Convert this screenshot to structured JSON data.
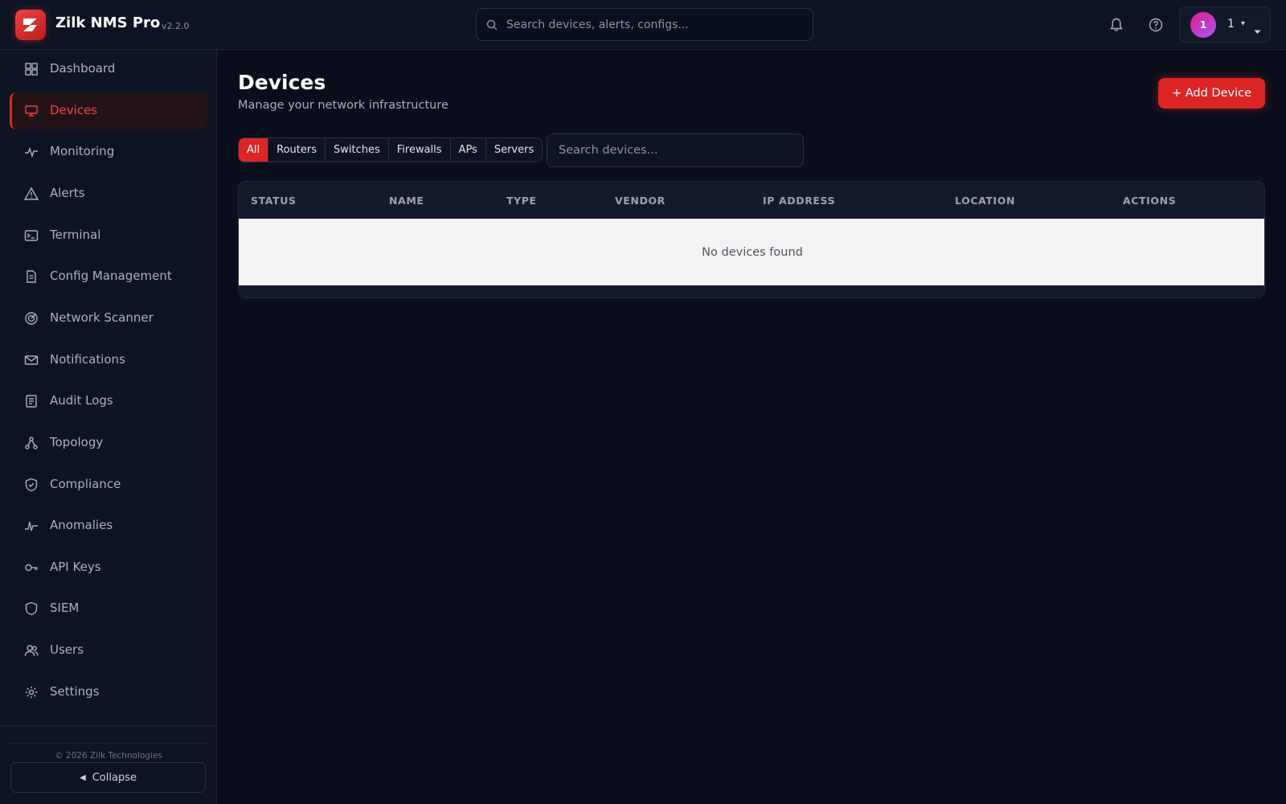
{
  "header": {
    "app_name": "Zilk NMS Pro",
    "version": "v2.2.0",
    "search_placeholder": "Search devices, alerts, configs...",
    "icons": [
      "bell-icon",
      "help-icon"
    ],
    "user": {
      "avatar_initial": "1",
      "name": "1",
      "caret": "▾"
    }
  },
  "sidebar": {
    "items": [
      {
        "label": "Dashboard",
        "icon": "dashboard-icon"
      },
      {
        "label": "Devices",
        "icon": "devices-icon",
        "active": true
      },
      {
        "label": "Monitoring",
        "icon": "monitoring-icon"
      },
      {
        "label": "Alerts",
        "icon": "alerts-icon"
      },
      {
        "label": "Terminal",
        "icon": "terminal-icon"
      },
      {
        "label": "Config Management",
        "icon": "config-icon"
      },
      {
        "label": "Network Scanner",
        "icon": "scanner-icon"
      },
      {
        "label": "Notifications",
        "icon": "envelope-icon"
      },
      {
        "label": "Audit Logs",
        "icon": "audit-icon"
      },
      {
        "label": "Topology",
        "icon": "topology-icon"
      },
      {
        "label": "Compliance",
        "icon": "compliance-icon"
      },
      {
        "label": "Anomalies",
        "icon": "anomalies-icon"
      },
      {
        "label": "API Keys",
        "icon": "key-icon"
      },
      {
        "label": "SIEM",
        "icon": "siem-icon"
      },
      {
        "label": "Users",
        "icon": "users-icon"
      },
      {
        "label": "Settings",
        "icon": "gear-icon"
      }
    ],
    "copyright": "© 2026 Zilk Technologies",
    "collapse_label": "Collapse",
    "collapse_glyph": "◀"
  },
  "main": {
    "title": "Devices",
    "subtitle": "Manage your network infrastructure",
    "add_button": "+ Add Device",
    "filters": [
      "All",
      "Routers",
      "Switches",
      "Firewalls",
      "APs",
      "Servers"
    ],
    "active_filter": "All",
    "search_placeholder": "Search devices...",
    "table": {
      "columns": [
        "STATUS",
        "NAME",
        "TYPE",
        "VENDOR",
        "IP ADDRESS",
        "LOCATION",
        "ACTIONS"
      ],
      "empty_message": "No devices found"
    }
  },
  "colors": {
    "accent": "#dc2626",
    "background": "#0a0e1a",
    "panel": "#0d1322"
  }
}
